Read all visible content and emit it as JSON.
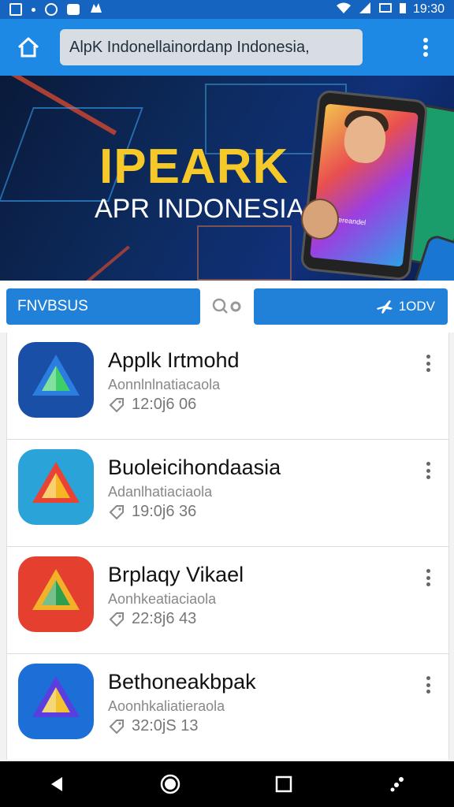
{
  "status_bar": {
    "time": "19:30",
    "left_icons": [
      "image-icon",
      "dot-icon",
      "circle-icon",
      "message-icon",
      "bird-icon"
    ],
    "right_icons": [
      "wifi-icon",
      "signal-icon",
      "data-icon",
      "battery-icon"
    ]
  },
  "app_bar": {
    "home_icon": "home-icon",
    "url_text": "AlpK Indonellainordanp Indonesia,",
    "menu_icon": "more-vert-icon"
  },
  "banner": {
    "title": "IPEARK",
    "subtitle": "APR INDONESIA",
    "phone_caption": "Gereandel"
  },
  "search_row": {
    "left_label": "FNVBSUS",
    "search_icon": "search-icon",
    "right_label": "1ODV",
    "right_icon": "plane-icon"
  },
  "apps": [
    {
      "name": "Applk Irtmohd",
      "subtitle": "Aonnlnlnatiacaola",
      "meta": "12:0j6 06",
      "colors": [
        "#1a4fa8",
        "#2b7de0",
        "#3ecf6a"
      ]
    },
    {
      "name": "Buoleicihondaasia",
      "subtitle": "Adanlhatiaciaola",
      "meta": "19:0j6 36",
      "colors": [
        "#29a3d8",
        "#e94335",
        "#f6b623"
      ]
    },
    {
      "name": "Brplaqy Vikael",
      "subtitle": "Aonhkeatiaciaola",
      "meta": "22:8j6 43",
      "colors": [
        "#e43f2f",
        "#f3b12a",
        "#2e9e4f"
      ]
    },
    {
      "name": "Bethoneakbpak",
      "subtitle": "Aoonhkaliatieraola",
      "meta": "32:0jS 13",
      "colors": [
        "#1b6fd6",
        "#5b3ee0",
        "#f2c230"
      ]
    }
  ],
  "nav_bar": {
    "back_icon": "back-icon",
    "home_icon": "home-circle-icon",
    "recents_icon": "recents-icon",
    "assist_icon": "assist-icon"
  }
}
